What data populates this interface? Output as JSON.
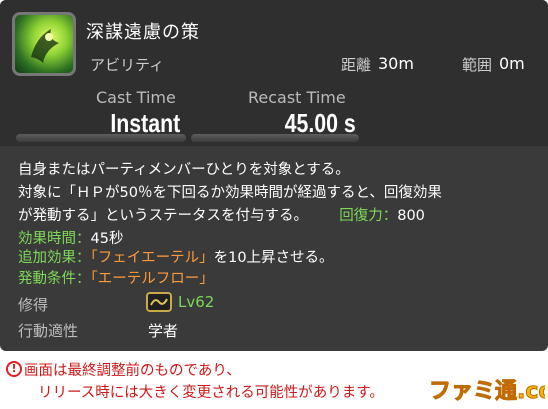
{
  "skill": {
    "name": "深謀遠慮の策",
    "type": "アビリティ",
    "range_label": "距離",
    "range_value": "30m",
    "radius_label": "範囲",
    "radius_value": "0m",
    "cast_label": "Cast Time",
    "cast_value": "Instant",
    "recast_label": "Recast Time",
    "recast_value": "45.00 s"
  },
  "description": {
    "line1": "自身またはパーティメンバーひとりを対象とする。",
    "line2": "対象に「ＨＰが50％を下回るか効果時間が経過すると、回復効果",
    "line3a": "が発動する」というステータスを付与する。",
    "potency_label": "回復力：",
    "potency_value": "800",
    "duration_label": "効果時間：",
    "duration_value": "45秒",
    "extra_label": "追加効果：",
    "extra_value_name": "「フェイエーテル」",
    "extra_value_rest": "を10上昇させる。",
    "condition_label": "発動条件：",
    "condition_value": "「エーテルフロー」"
  },
  "acquire": {
    "label": "修得",
    "level": "Lv62"
  },
  "job": {
    "label": "行動適性",
    "value": "学者"
  },
  "note": {
    "line1": "画面は最終調整前のものであり、",
    "line2": "リリース時には大きく変更される可能性があります。"
  },
  "logo_text": "ファミ通.com",
  "colors": {
    "accent_green": "#7ed957",
    "accent_orange": "#ff9a3c",
    "warning_red": "#d01818"
  }
}
